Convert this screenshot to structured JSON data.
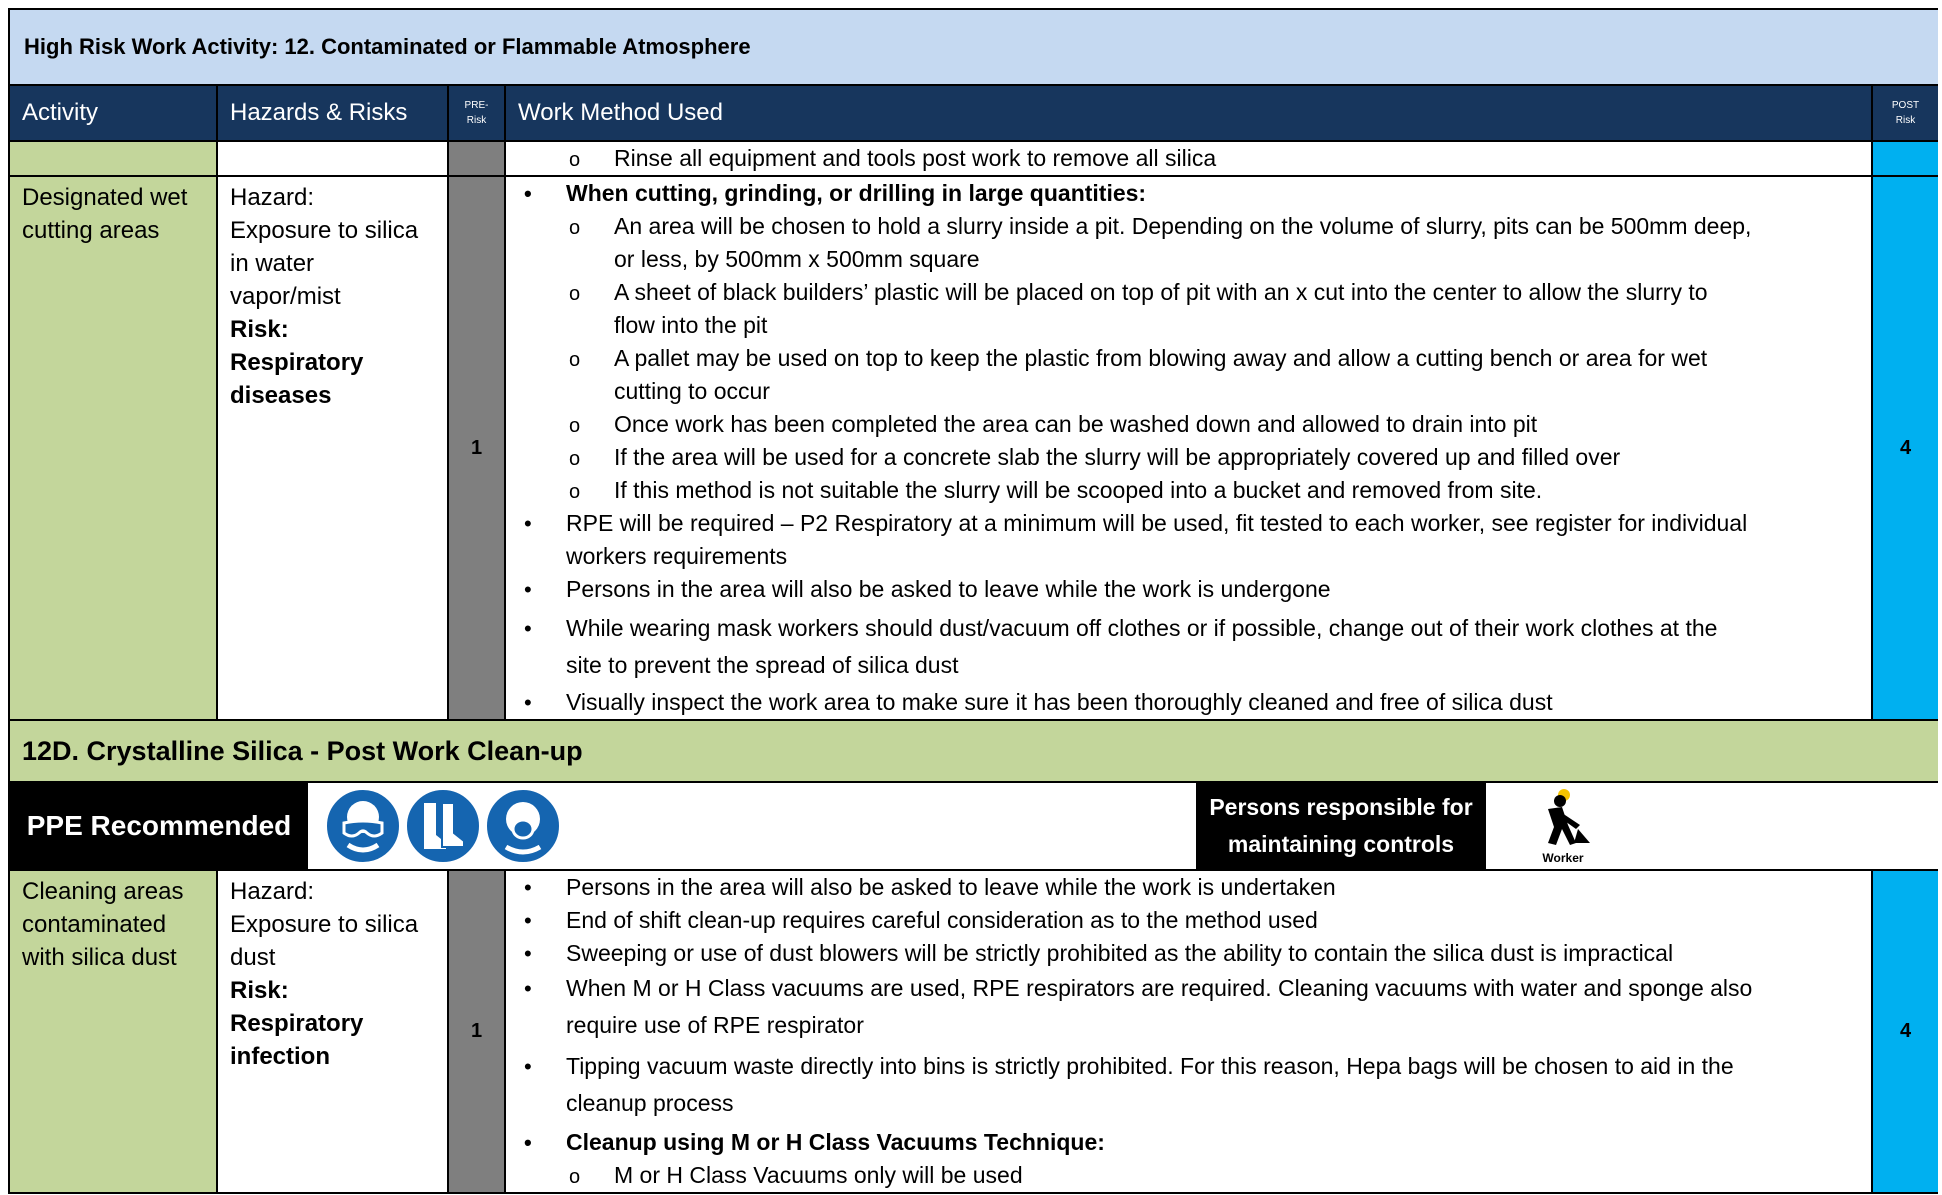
{
  "header": {
    "title": "High Risk Work Activity: 12. Contaminated or Flammable Atmosphere",
    "col_activity": "Activity",
    "col_hazards": "Hazards & Risks",
    "col_pre_1": "PRE-",
    "col_pre_2": "Risk",
    "col_method": "Work Method Used",
    "col_post_1": "POST",
    "col_post_2": "Risk"
  },
  "top_row": {
    "item": "Rinse all equipment and tools post work to remove all silica"
  },
  "wet_cutting": {
    "activity": [
      "Designated wet",
      "cutting areas"
    ],
    "hazard_label": "Hazard:",
    "hazard_lines": [
      "Exposure to silica",
      "in water",
      "vapor/mist"
    ],
    "risk_label": "Risk:",
    "risk_lines": [
      "Respiratory",
      "diseases"
    ],
    "pre_risk": "1",
    "post_risk": "4",
    "lead": "When cutting, grinding, or drilling in large quantities:",
    "sub": [
      [
        "An area will be chosen to hold a slurry inside a pit. Depending on the volume of slurry, pits can be 500mm deep,",
        "or less, by 500mm x 500mm square"
      ],
      [
        "A sheet of black builders’ plastic will be placed on top of pit with an x cut into the center to allow the slurry to",
        "flow into the pit"
      ],
      [
        "A pallet may be used on top to keep the plastic from blowing away and allow a cutting bench or area for wet",
        "cutting to occur"
      ],
      [
        "Once work has been completed the area can be washed down and allowed to drain into pit"
      ],
      [
        "If the area will be used for a concrete slab the slurry will be appropriately covered up and filled over"
      ],
      [
        "If this method is not suitable the slurry will be scooped into a bucket and removed from site."
      ]
    ],
    "bullets": [
      [
        "RPE will be required – P2 Respiratory at a minimum will be used, fit tested to each worker, see register for individual",
        "workers requirements"
      ],
      [
        "Persons in the area will also be asked to leave while the work is undergone"
      ],
      [
        "While wearing mask workers should dust/vacuum off clothes or if possible, change out of their work clothes at the",
        "site to prevent the spread of silica dust"
      ],
      [
        "Visually inspect the work area to make sure it has been thoroughly cleaned and free of silica dust"
      ]
    ]
  },
  "section": {
    "title": "12D. Crystalline Silica - Post Work Clean-up"
  },
  "ppe": {
    "label": "PPE Recommended",
    "icons": [
      "safety-glasses-icon",
      "safety-boots-icon",
      "dust-mask-icon"
    ],
    "responsible_1": "Persons responsible for",
    "responsible_2": "maintaining controls",
    "worker_label": "Worker"
  },
  "cleaning": {
    "activity": [
      "Cleaning areas",
      "contaminated",
      "with silica dust"
    ],
    "hazard_label": "Hazard:",
    "hazard_lines": [
      "Exposure to silica",
      "dust"
    ],
    "risk_label": "Risk:",
    "risk_lines": [
      "Respiratory",
      "infection"
    ],
    "pre_risk": "1",
    "post_risk": "4",
    "bullets": [
      [
        "Persons in the area will also be asked to leave while the work is undertaken"
      ],
      [
        "End of shift clean-up requires careful consideration as to the method used"
      ],
      [
        "Sweeping or use of dust blowers will be strictly prohibited as the ability to contain the silica dust is impractical"
      ],
      [
        "When M or H Class vacuums are used, RPE respirators are required. Cleaning vacuums with water and sponge also",
        "require use of RPE respirator"
      ],
      [
        "Tipping vacuum waste directly into bins is strictly prohibited. For this reason, Hepa bags will be chosen to aid in the",
        "cleanup process"
      ]
    ],
    "lead": "Cleanup using M or H Class Vacuums Technique:",
    "sub": [
      "M or H Class Vacuums only will be used"
    ]
  },
  "colors": {
    "title_bg": "#c5d9f1",
    "header_bg": "#17365d",
    "activity_bg": "#c3d69b",
    "pre_risk_bg": "#7f7f7f",
    "post_risk_bg": "#00b0f0",
    "ppe_blue": "#1565b0"
  }
}
